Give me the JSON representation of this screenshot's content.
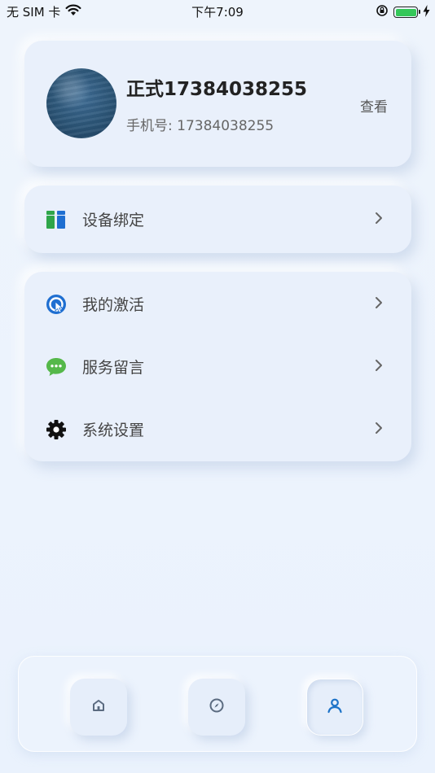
{
  "status_bar": {
    "carrier": "无 SIM 卡",
    "time": "下午7:09",
    "battery_level": 1.0
  },
  "profile": {
    "name": "正式17384038255",
    "phone": "手机号: 17384038255",
    "view_label": "查看"
  },
  "device": {
    "label": "设备绑定",
    "icon": "device-bind-icon"
  },
  "menu": {
    "items": [
      {
        "label": "我的激活",
        "icon": "activation-icon"
      },
      {
        "label": "服务留言",
        "icon": "message-icon"
      },
      {
        "label": "系统设置",
        "icon": "settings-gear-icon"
      }
    ]
  },
  "tabbar": {
    "tabs": [
      {
        "icon": "home-icon",
        "active": false
      },
      {
        "icon": "compass-icon",
        "active": false
      },
      {
        "icon": "profile-icon",
        "active": true
      }
    ],
    "colors": {
      "inactive": "#5b6b80",
      "active": "#1d73c8"
    }
  },
  "colors": {
    "background": "#edf3fc",
    "card": "#e9f0fb",
    "battery": "#34c759"
  }
}
